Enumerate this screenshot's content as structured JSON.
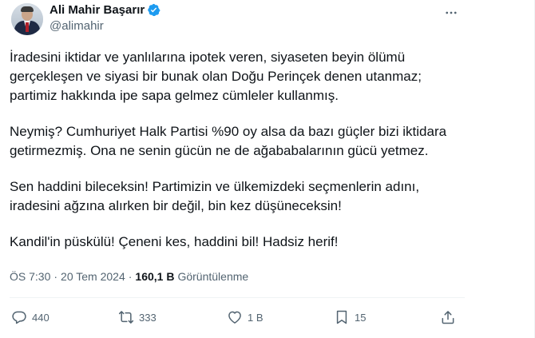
{
  "author": {
    "display_name": "Ali Mahir Başarır",
    "handle": "@alimahir",
    "verified": true,
    "verified_color": "#1d9bf0"
  },
  "tweet": {
    "paragraphs": [
      "İradesini iktidar ve yanlılarına ipotek veren, siyaseten beyin ölümü gerçekleşen ve siyasi bir bunak olan Doğu Perinçek denen utanmaz; partimiz hakkında ipe sapa gelmez cümleler kullanmış.",
      "Neymiş? Cumhuriyet Halk Partisi %90 oy alsa da bazı güçler bizi iktidara getirmezmiş. Ona ne senin gücün ne de ağababalarının gücü yetmez.",
      "Sen haddini bileceksin! Partimizin ve ülkemizdeki seçmenlerin adını, iradesini ağzına alırken bir değil, bin kez düşüneceksin!",
      "Kandil'in püskülü! Çeneni kes, haddini bil! Hadsiz herif!"
    ]
  },
  "meta": {
    "time": "ÖS 7:30",
    "separator": "·",
    "date": "20 Tem 2024",
    "views_count": "160,1 B",
    "views_label": "Görüntülenme"
  },
  "actions": {
    "reply_count": "440",
    "retweet_count": "333",
    "like_count": "1 B",
    "bookmark_count": "15"
  },
  "icons": {
    "reply": "reply-icon",
    "retweet": "retweet-icon",
    "like": "heart-icon",
    "bookmark": "bookmark-icon",
    "share": "share-icon",
    "more": "more-icon"
  }
}
